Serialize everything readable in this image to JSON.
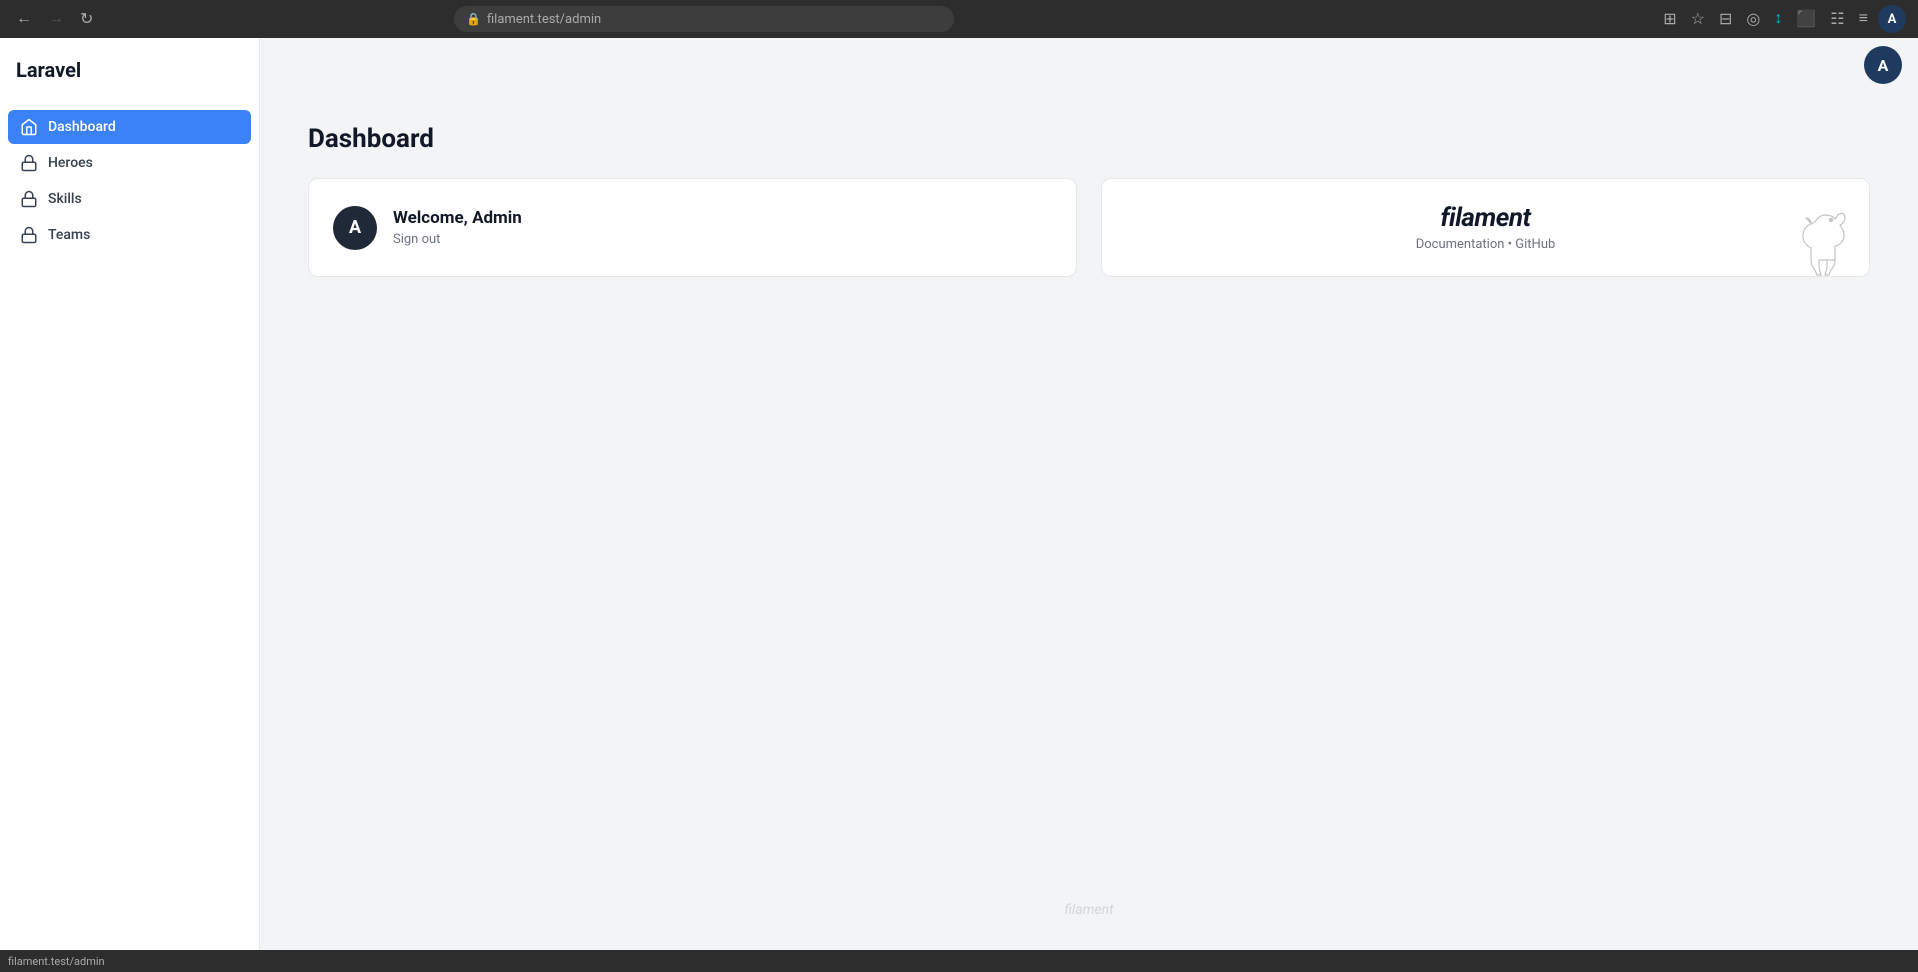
{
  "browser": {
    "url_prefix": "filament.test",
    "url_path": "/admin",
    "back_disabled": false,
    "forward_disabled": true
  },
  "sidebar": {
    "logo": "Laravel",
    "nav_items": [
      {
        "id": "dashboard",
        "label": "Dashboard",
        "icon": "home-icon",
        "active": true
      },
      {
        "id": "heroes",
        "label": "Heroes",
        "icon": "shield-icon",
        "active": false
      },
      {
        "id": "skills",
        "label": "Skills",
        "icon": "lock-icon",
        "active": false
      },
      {
        "id": "teams",
        "label": "Teams",
        "icon": "lock-icon-2",
        "active": false
      }
    ]
  },
  "main": {
    "page_title": "Dashboard",
    "welcome_card": {
      "avatar_letter": "A",
      "greeting": "Welcome, Admin",
      "sign_out_label": "Sign out"
    },
    "filament_card": {
      "brand": "filament",
      "documentation_label": "Documentation",
      "separator": "•",
      "github_label": "GitHub"
    },
    "footer_brand": "filament"
  },
  "status_bar": {
    "url": "filament.test/admin"
  },
  "user_avatar": {
    "letter": "A"
  }
}
